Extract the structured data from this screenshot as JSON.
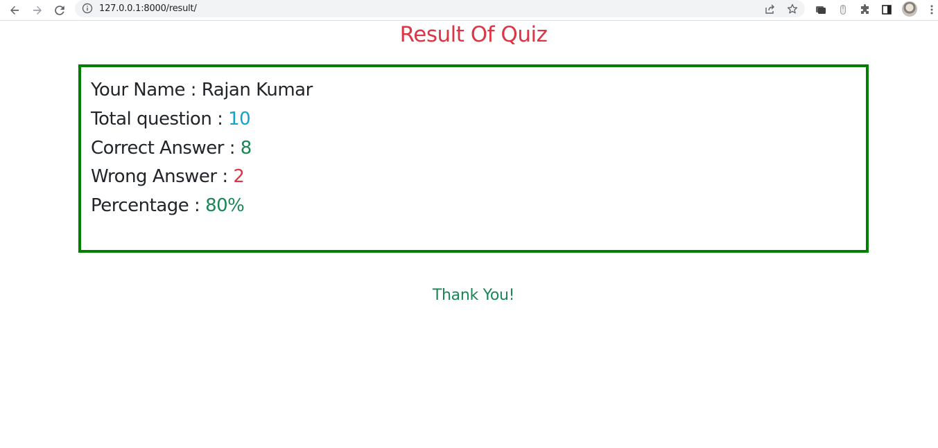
{
  "browser": {
    "url": "127.0.0.1:8000/result/"
  },
  "page": {
    "title": "Result Of Quiz",
    "thank_you": "Thank You!"
  },
  "result": {
    "name_label": "Your Name : ",
    "name_value": "Rajan Kumar",
    "total_label": "Total question : ",
    "total_value": "10",
    "correct_label": "Correct Answer : ",
    "correct_value": "8",
    "wrong_label": "Wrong Answer : ",
    "wrong_value": "2",
    "percentage_label": "Percentage : ",
    "percentage_value": "80%"
  },
  "colors": {
    "title": "#dc3545",
    "border": "#008000",
    "info": "#17a2c8",
    "success": "#198754",
    "danger": "#dc3545"
  },
  "icons": [
    "back-arrow-icon",
    "forward-arrow-icon",
    "reload-icon",
    "info-icon",
    "share-icon",
    "star-icon",
    "extension-icon",
    "puzzle-icon",
    "side-panel-icon",
    "menu-dots-icon"
  ]
}
